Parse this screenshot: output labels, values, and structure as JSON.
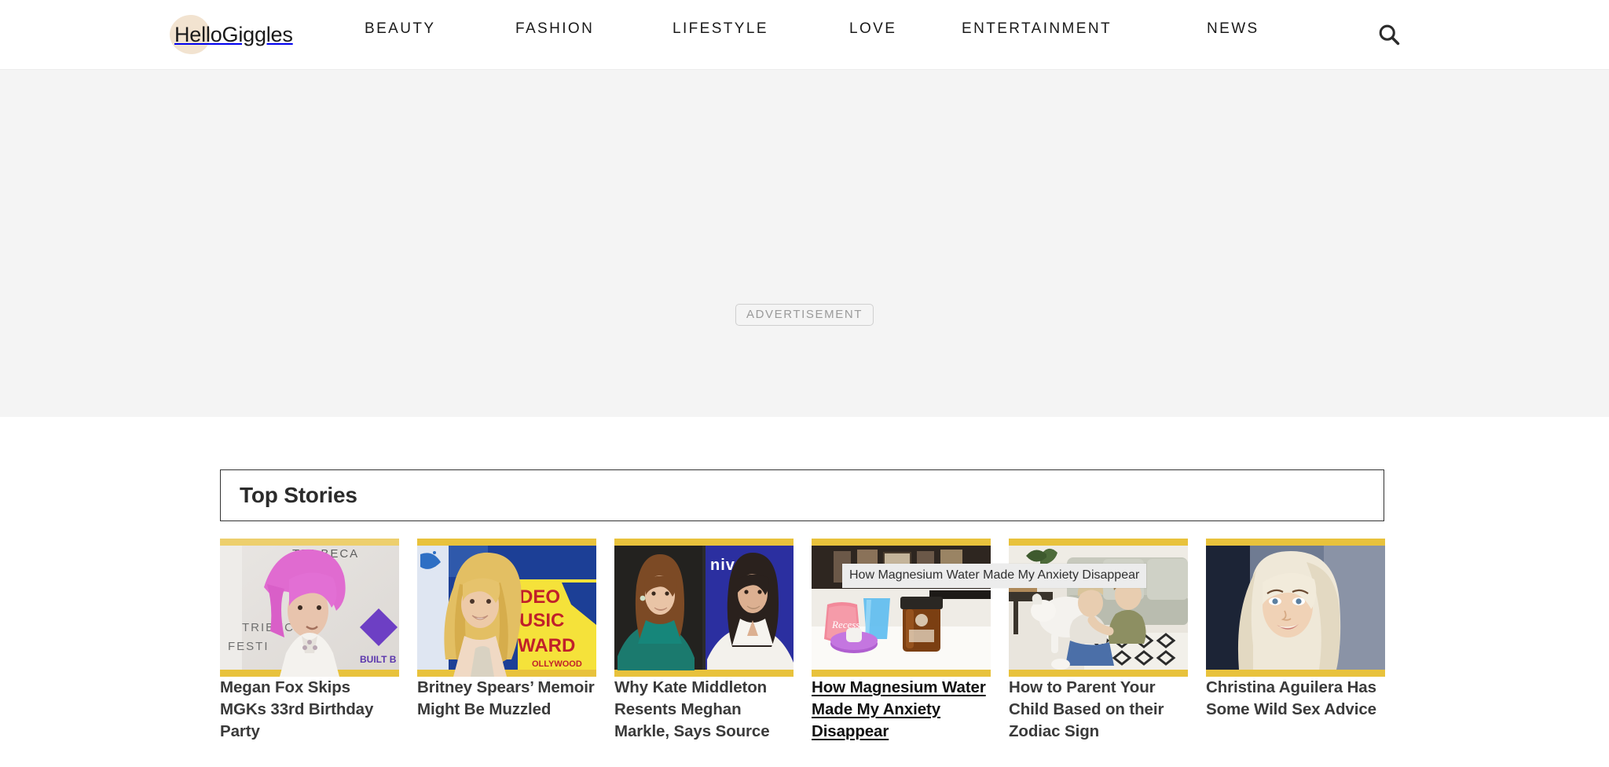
{
  "header": {
    "brand": "HelloGiggles",
    "brand_blob_color": "#f2e3d0",
    "nav": [
      {
        "label": "BEAUTY",
        "name": "beauty"
      },
      {
        "label": "FASHION",
        "name": "fashion"
      },
      {
        "label": "LIFESTYLE",
        "name": "lifestyle"
      },
      {
        "label": "LOVE",
        "name": "love"
      },
      {
        "label": "ENTERTAINMENT",
        "name": "entertainment"
      },
      {
        "label": "NEWS",
        "name": "news"
      }
    ],
    "search_icon": "search-icon"
  },
  "advertisement": {
    "label": "ADVERTISEMENT",
    "background": "#f4f4f4",
    "border_color": "#cfcfcf",
    "text_color": "#9a9a9a"
  },
  "top_stories": {
    "title": "Top Stories",
    "border_color": "#333333",
    "cards": [
      {
        "title": "Megan Fox Skips MGKs 33rd Birthday Party",
        "image_alt": "Machine Gun Kelly with pink hair at Tribeca Festival",
        "hovered": false
      },
      {
        "title": "Britney Spears’ Memoir Might Be Muzzled",
        "image_alt": "Britney Spears at the Video Music Awards",
        "hovered": false
      },
      {
        "title": "Why Kate Middleton Resents Meghan Markle, Says Source",
        "image_alt": "Split photo of Kate Middleton and Meghan Markle",
        "hovered": false
      },
      {
        "title": "How Magnesium Water Made My Anxiety Disappear",
        "image_alt": "Pink drink pouch, blue glass and amber magnesium jar on a counter",
        "hovered": true
      },
      {
        "title": "How to Parent Your Child Based on their Zodiac Sign",
        "image_alt": "Children playing with a white dog on a living room rug",
        "hovered": false
      },
      {
        "title": "Christina Aguilera Has Some Wild Sex Advice",
        "image_alt": "Christina Aguilera with long platinum blonde hair",
        "hovered": false
      }
    ]
  },
  "tooltip": {
    "text": "How Magnesium Water Made My Anxiety Disappear",
    "background": "#ececec"
  }
}
